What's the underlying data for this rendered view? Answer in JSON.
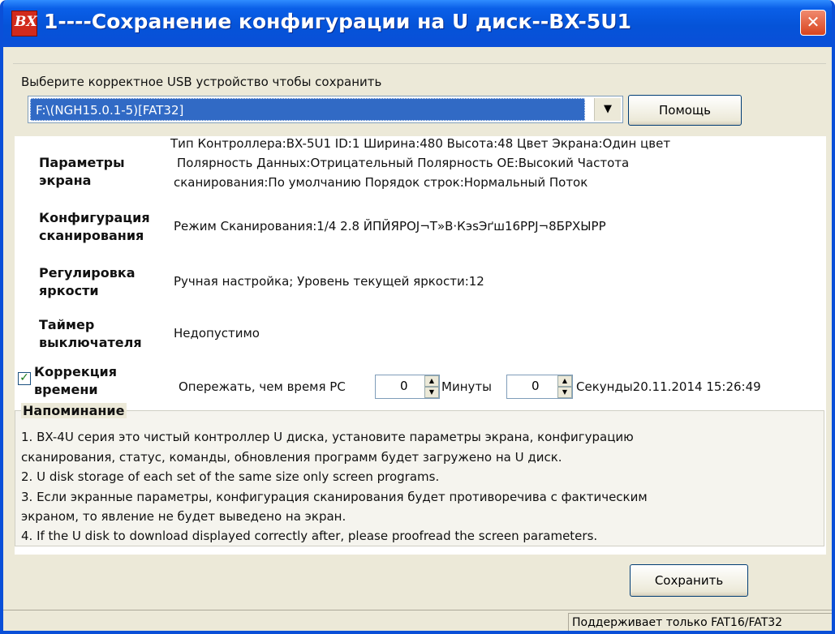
{
  "window": {
    "app_icon_text": "BX",
    "title": "1----Сохранение конфигурации на U диск--BX-5U1",
    "close_glyph": "✕"
  },
  "device": {
    "label": "Выберите корректное USB устройство чтобы сохранить",
    "selected": "F:\\(NGH15.0.1-5)[FAT32]",
    "dropdown_glyph": "▼",
    "help_label": "Помощь"
  },
  "screen_params": {
    "label_line1": "Параметры",
    "label_line2": "экрана",
    "line1": "Тип Контроллера:BX-5U1   ID:1   Ширина:480   Высота:48   Цвет Экрана:Один цвет",
    "line2": "Полярность Данных:Отрицательный  Полярность OE:Высокий  Частота",
    "line3": "сканирования:По умолчанию  Порядок строк:Нормальный  Поток"
  },
  "scan_config": {
    "label_line1": "Конфигурация",
    "label_line2": "сканирования",
    "value": "Режим Сканирования:1/4     2.8  ЙПЙЯРОJ¬Т»В·КэsЭґш16РРJ¬8БРХЫРР"
  },
  "brightness": {
    "label_line1": "Регулировка",
    "label_line2": "яркости",
    "value": "Ручная настройка;  Уровень текущей яркости:12"
  },
  "timer": {
    "label_line1": "Таймер",
    "label_line2": "выключателя",
    "value": "Недопустимо"
  },
  "time_correction": {
    "checked": true,
    "check_glyph": "✓",
    "label_line1": "Коррекция",
    "label_line2": "времени",
    "prefix": "Опережать, чем время PC",
    "minutes_value": "0",
    "minutes_label": "Минуты",
    "seconds_value": "0",
    "seconds_label": "Секунды",
    "datetime": "20.11.2014 15:26:49",
    "spin_up": "▲",
    "spin_down": "▼"
  },
  "notice": {
    "title": "Напоминание",
    "lines": [
      " 1.  BX-4U серия это чистый контроллер U диска, установите параметры экрана, конфигурацию",
      "сканирования, статус, команды, обновления программ будет загружено на U диск.",
      " 2.  U disk storage of each set of the same size only screen programs.",
      " 3.  Если экранные параметры, конфигурация сканирования будет противоречива с фактическим",
      "экраном, то явление не будет выведено на экран.",
      " 4.  If the U disk to download displayed correctly after, please proofread the screen parameters."
    ]
  },
  "actions": {
    "save_label": "Сохранить"
  },
  "status": {
    "text": "Поддерживает только FAT16/FAT32"
  }
}
